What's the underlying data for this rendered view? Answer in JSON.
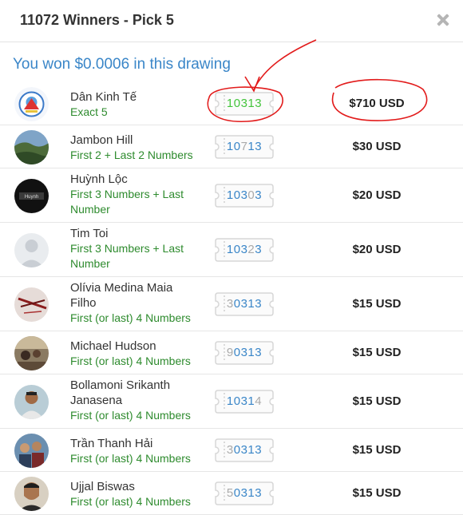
{
  "dialog": {
    "title": "11072 Winners - Pick 5",
    "won_message": "You won $0.0006 in this drawing"
  },
  "icons": {
    "close": "close-icon",
    "ticket": "ticket-icon"
  },
  "colors": {
    "accent": "#3a86c8",
    "match_text": "#2e8b2e",
    "digit_match": "#3a86c8",
    "digit_miss": "#aaaaaa",
    "digit_highlight": "#43c43b",
    "annotation": "#e21b1b"
  },
  "winners": [
    {
      "name": "Dân Kinh Tế",
      "match": "Exact 5",
      "number": "10313",
      "prize": "$710 USD"
    },
    {
      "name": "Jambon Hill",
      "match": "First 2 + Last 2 Numbers",
      "number": "10713",
      "prize": "$30 USD"
    },
    {
      "name": "Huỳnh Lộc",
      "match": "First 3 Numbers + Last Number",
      "number": "10303",
      "prize": "$20 USD"
    },
    {
      "name": "Tim Toi",
      "match": "First 3 Numbers + Last Number",
      "number": "10323",
      "prize": "$20 USD"
    },
    {
      "name": "Olívia Medina Maia Filho",
      "match": "First (or last) 4 Numbers",
      "number": "30313",
      "prize": "$15 USD"
    },
    {
      "name": "Michael Hudson",
      "match": "First (or last) 4 Numbers",
      "number": "90313",
      "prize": "$15 USD"
    },
    {
      "name": "Bollamoni Srikanth Janasena",
      "match": "First (or last) 4 Numbers",
      "number": "10314",
      "prize": "$15 USD"
    },
    {
      "name": "Trần Thanh Hải",
      "match": "First (or last) 4 Numbers",
      "number": "30313",
      "prize": "$15 USD"
    },
    {
      "name": "Ujjal Biswas",
      "match": "First (or last) 4 Numbers",
      "number": "50313",
      "prize": "$15 USD"
    }
  ]
}
